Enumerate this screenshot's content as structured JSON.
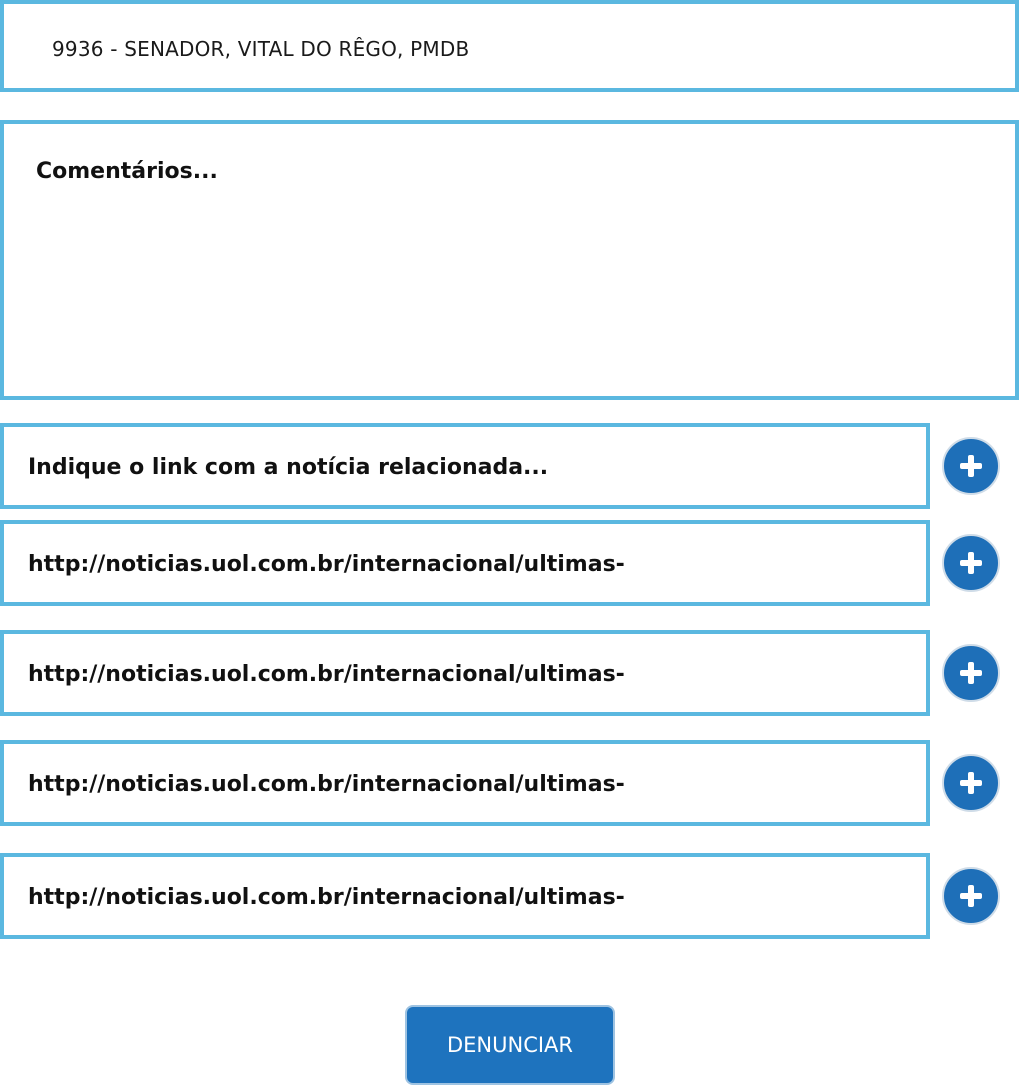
{
  "candidate": {
    "value": "9936 - SENADOR, VITAL DO RÊGO, PMDB"
  },
  "comments": {
    "placeholder": "Comentários..."
  },
  "links": [
    {
      "text": "Indique o link com a notícia relacionada..."
    },
    {
      "text": "http://noticias.uol.com.br/internacional/ultimas-"
    },
    {
      "text": "http://noticias.uol.com.br/internacional/ultimas-"
    },
    {
      "text": "http://noticias.uol.com.br/internacional/ultimas-"
    },
    {
      "text": "http://noticias.uol.com.br/internacional/ultimas-"
    }
  ],
  "add_icon": "plus-icon",
  "submit": {
    "label": "DENUNCIAR"
  },
  "colors": {
    "border": "#5bb8e0",
    "button": "#1e73be"
  }
}
